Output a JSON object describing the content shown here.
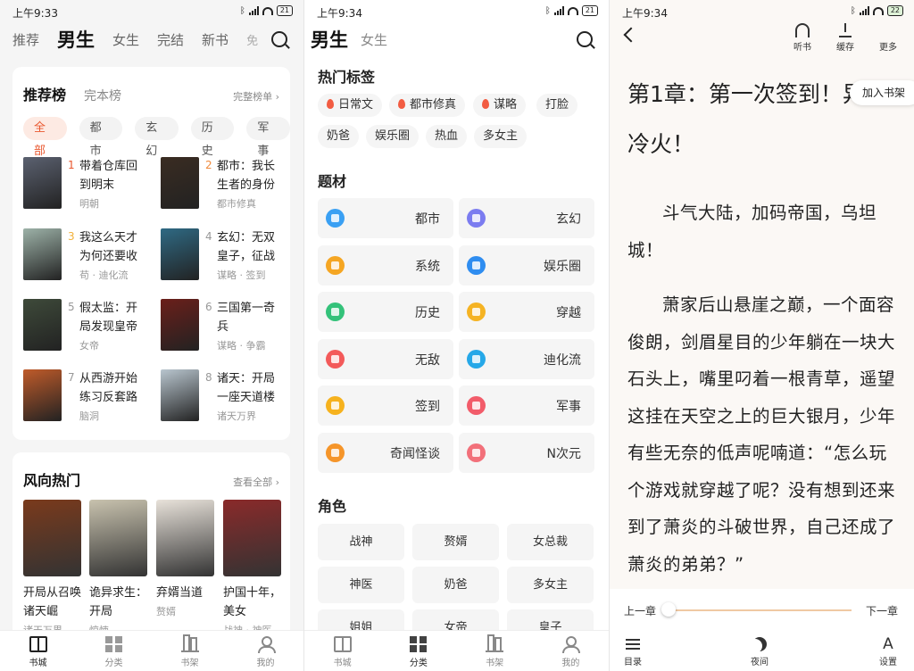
{
  "status": {
    "p1_time": "上午9:33",
    "p2_time": "上午9:34",
    "p3_time": "上午9:34",
    "p1_battery": "21",
    "p2_battery": "21",
    "p3_battery": "22",
    "network": "HD"
  },
  "panel1": {
    "tabs": [
      "推荐",
      "男生",
      "女生",
      "完结",
      "新书",
      "免"
    ],
    "rank_card": {
      "title": "推荐榜",
      "alt_title": "完本榜",
      "more": "完整榜单 ›",
      "chips": [
        "全部",
        "都市",
        "玄幻",
        "历史",
        "军事"
      ],
      "items": [
        {
          "num": "1",
          "title": "带着仓库回到明末",
          "sub": "明朝",
          "cover": "#5b6170"
        },
        {
          "num": "2",
          "title": "都市：我长生者的身份",
          "sub": "都市修真",
          "cover": "#3a2c22"
        },
        {
          "num": "3",
          "title": "我这么天才为何还要收",
          "sub": "苟 · 迪化流",
          "cover": "#9db2a8"
        },
        {
          "num": "4",
          "title": "玄幻：无双皇子，征战",
          "sub": "谋略 · 签到",
          "cover": "#2f6a84"
        },
        {
          "num": "5",
          "title": "假太监：开局发现皇帝",
          "sub": "女帝",
          "cover": "#3e4a3a"
        },
        {
          "num": "6",
          "title": "三国第一奇兵",
          "sub": "谋略 · 争霸",
          "cover": "#6b1f1a"
        },
        {
          "num": "7",
          "title": "从西游开始练习反套路",
          "sub": "脑洞",
          "cover": "#c05b2a"
        },
        {
          "num": "8",
          "title": "诸天：开局一座天道楼",
          "sub": "诸天万界",
          "cover": "#b9c6cf"
        }
      ]
    },
    "trend_card": {
      "title": "风向热门",
      "more": "查看全部 ›",
      "items": [
        {
          "title": "开局从召唤诸天崛",
          "sub": "诸天万界",
          "cover": "#7a3a1c"
        },
        {
          "title": "诡异求生：开局",
          "sub": "惊悚",
          "cover": "#c8c2ae"
        },
        {
          "title": "弃婿当道",
          "sub": "赘婿",
          "cover": "#e8e2da"
        },
        {
          "title": "护国十年，美女",
          "sub": "战神 · 神医",
          "cover": "#8a2a2a"
        }
      ]
    }
  },
  "panel2": {
    "tabs": [
      "男生",
      "女生"
    ],
    "hot_tags_title": "热门标签",
    "hot_tags": [
      {
        "label": "日常文",
        "fire": true
      },
      {
        "label": "都市修真",
        "fire": true
      },
      {
        "label": "谋略",
        "fire": true
      },
      {
        "label": "打脸",
        "fire": false
      },
      {
        "label": "奶爸",
        "fire": false
      },
      {
        "label": "娱乐圈",
        "fire": false
      },
      {
        "label": "热血",
        "fire": false
      },
      {
        "label": "多女主",
        "fire": false
      }
    ],
    "genre_title": "题材",
    "genres": [
      {
        "label": "都市",
        "color": "#3aa0f3"
      },
      {
        "label": "玄幻",
        "color": "#7b7cf0"
      },
      {
        "label": "系统",
        "color": "#f5a623"
      },
      {
        "label": "娱乐圈",
        "color": "#2f8df0"
      },
      {
        "label": "历史",
        "color": "#34c27a"
      },
      {
        "label": "穿越",
        "color": "#f5b323"
      },
      {
        "label": "无敌",
        "color": "#f35a5a"
      },
      {
        "label": "迪化流",
        "color": "#26a8e8"
      },
      {
        "label": "签到",
        "color": "#f6b21e"
      },
      {
        "label": "军事",
        "color": "#f25c6a"
      },
      {
        "label": "奇闻怪谈",
        "color": "#f5952a"
      },
      {
        "label": "N次元",
        "color": "#f2707a"
      }
    ],
    "role_title": "角色",
    "roles": [
      "战神",
      "赘婿",
      "女总裁",
      "神医",
      "奶爸",
      "多女主",
      "姐姐",
      "女帝",
      "皇子"
    ]
  },
  "panel3": {
    "actions": [
      "听书",
      "缓存",
      "更多"
    ],
    "chapter_title": "第1章：第一次签到！异灵冷火！",
    "add_shelf": "加入书架",
    "paragraphs": [
      "斗气大陆，加码帝国，乌坦城！",
      "萧家后山悬崖之巅，一个面容俊朗，剑眉星目的少年躺在一块大石头上，嘴里叼着一根青草，遥望这挂在天空之上的巨大银月，少年有些无奈的低声呢喃道：“怎么玩个游戏就穿越了呢？没有想到还来到了萧炎的斗破世界，自己还成了萧炎的弟弟？”"
    ],
    "prev": "上一章",
    "next": "下一章",
    "progress": 0.0,
    "bottom": [
      "目录",
      "夜间",
      "设置"
    ]
  },
  "bottom_nav": [
    "书城",
    "分类",
    "书架",
    "我的"
  ],
  "colors": {
    "accent": "#e9572e",
    "progress": "#f0c9a3"
  }
}
